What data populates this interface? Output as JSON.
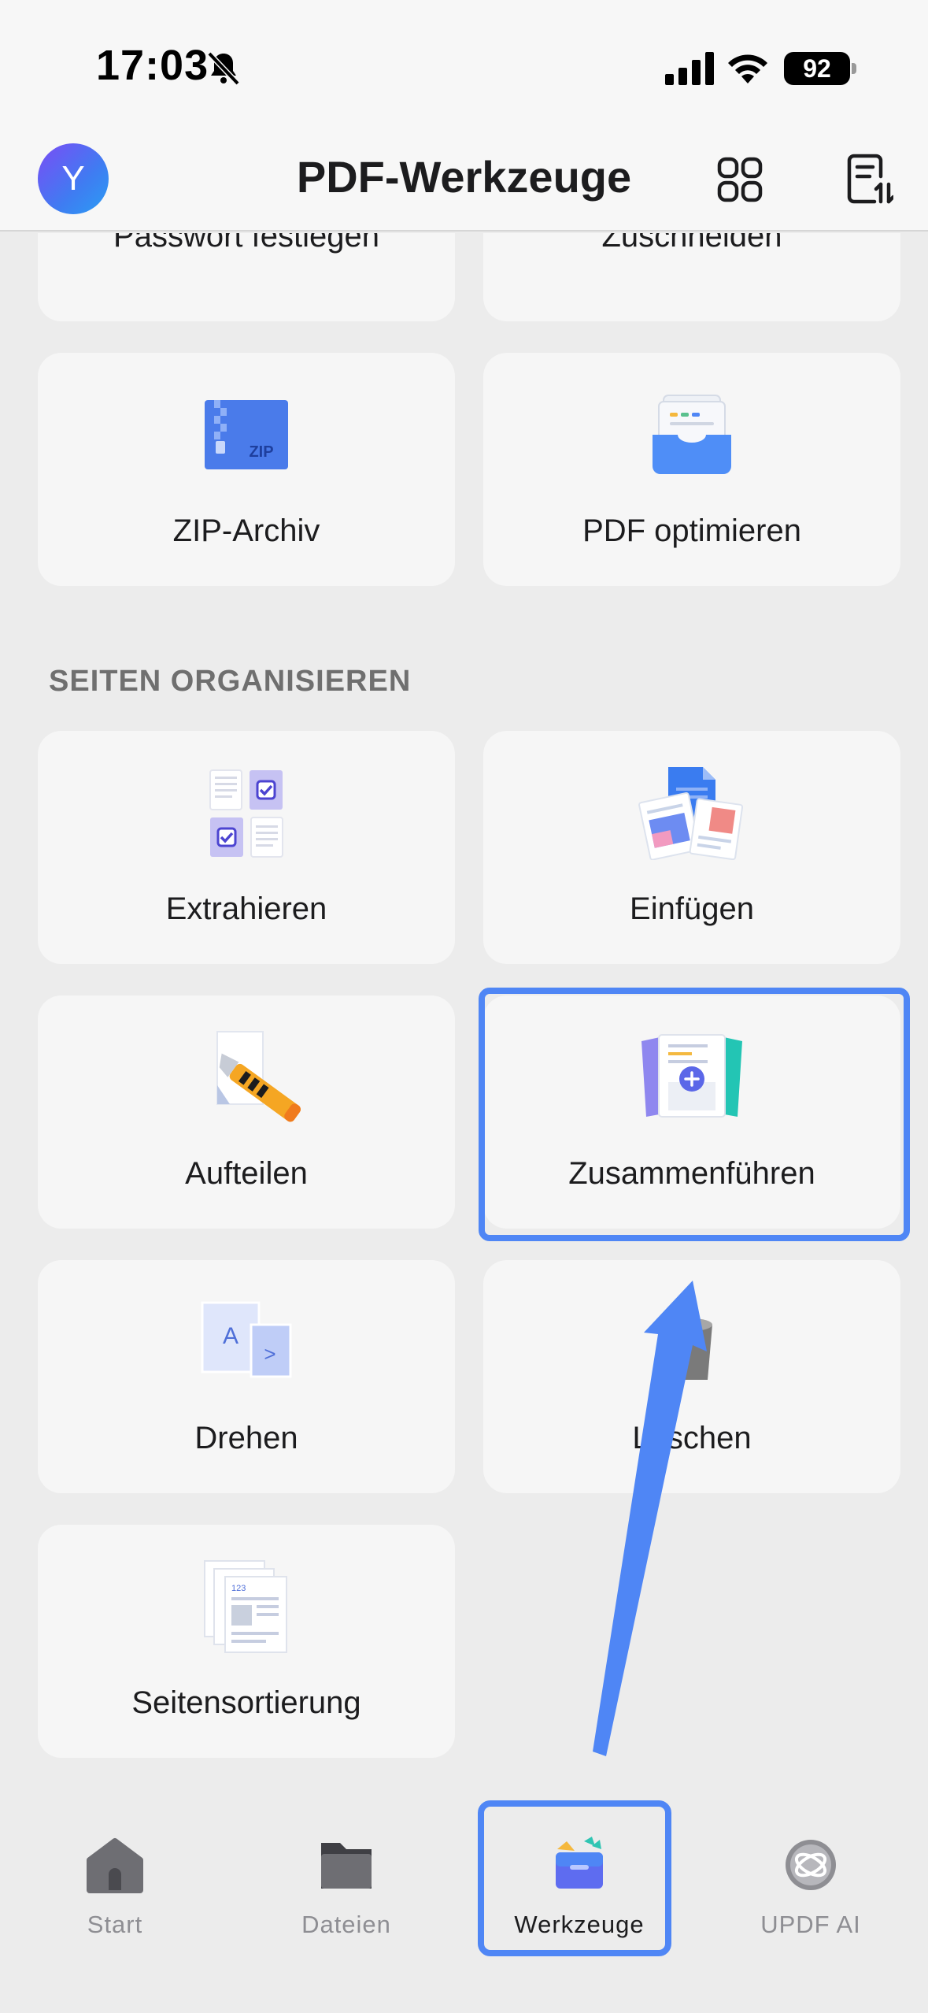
{
  "status": {
    "time": "17:03",
    "battery": "92"
  },
  "header": {
    "avatar_initial": "Y",
    "title": "PDF-Werkzeuge"
  },
  "tools_top": {
    "password": "Passwort festlegen",
    "crop": "Zuschneiden",
    "zip": "ZIP-Archiv",
    "zip_icon_text": "ZIP",
    "optimize": "PDF optimieren"
  },
  "section_organize": {
    "title": "SEITEN ORGANISIEREN",
    "extract": "Extrahieren",
    "insert": "Einfügen",
    "split": "Aufteilen",
    "merge": "Zusammenführen",
    "rotate": "Drehen",
    "delete": "Löschen",
    "reorder": "Seitensortierung"
  },
  "icons": {
    "zip": "zip-archive-icon",
    "optimize": "inbox-tray-icon",
    "extract": "checklist-pages-icon",
    "insert": "insert-pages-icon",
    "split": "cutter-knife-icon",
    "merge": "merge-pages-icon",
    "rotate": "rotate-page-icon",
    "delete": "trash-can-icon",
    "reorder": "stacked-pages-icon"
  },
  "tabs": [
    {
      "label": "Start",
      "icon": "house-icon"
    },
    {
      "label": "Dateien",
      "icon": "folder-icon"
    },
    {
      "label": "Werkzeuge",
      "icon": "toolbox-icon"
    },
    {
      "label": "UPDF AI",
      "icon": "ai-logo-icon"
    }
  ],
  "colors": {
    "accent": "#4f86f5",
    "card": "#f6f6f6",
    "background": "#ececec"
  }
}
